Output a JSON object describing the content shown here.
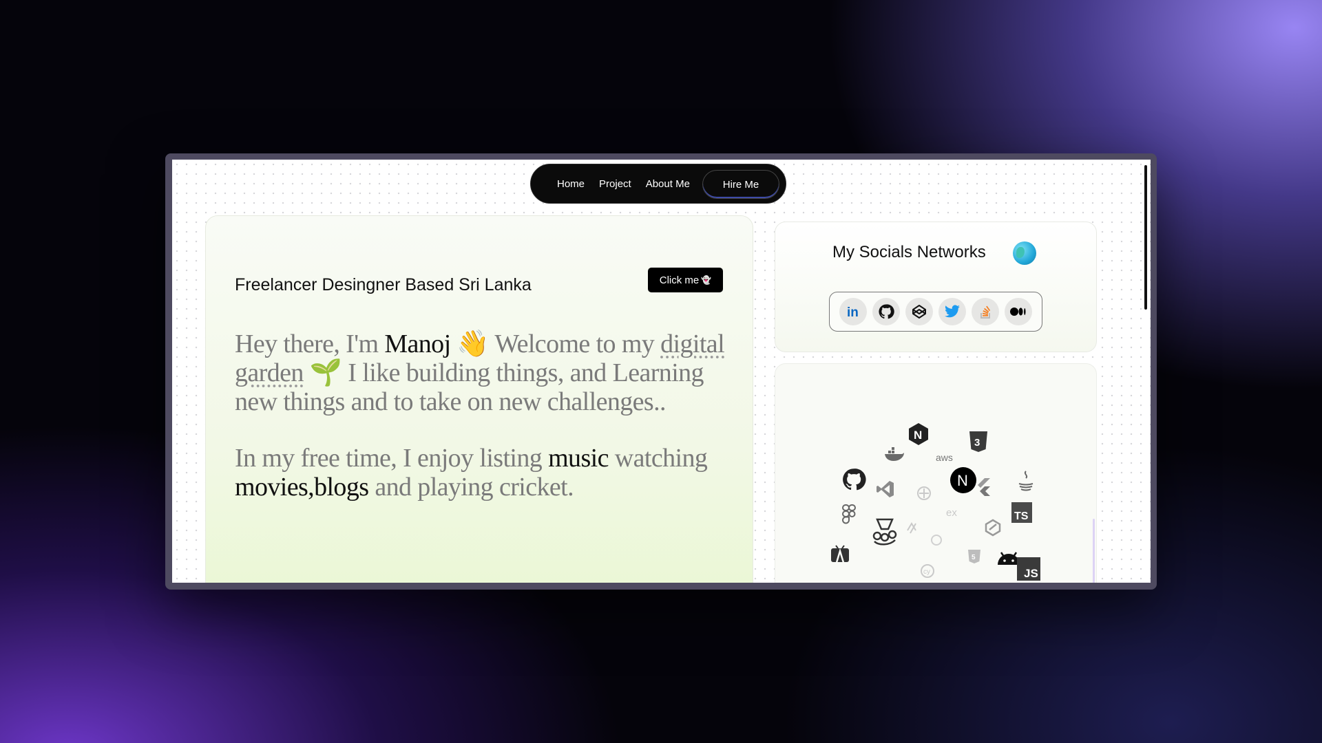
{
  "nav": {
    "items": [
      "Home",
      "Project",
      "About Me"
    ],
    "hire_label": "Hire Me"
  },
  "hero": {
    "tagline": "Freelancer Desingner Based Sri Lanka",
    "click_label": "Click me",
    "click_icon": "ghost-icon",
    "p1": [
      {
        "t": "Hey there, I'm ",
        "s": ""
      },
      {
        "t": "Manoj",
        "s": "hl"
      },
      {
        "t": " 👋 Welcome to my ",
        "s": ""
      },
      {
        "t": "digital garden",
        "s": "dotted"
      },
      {
        "t": " 🌱 I like building things, and Learning new things and to take on new challenges..",
        "s": ""
      }
    ],
    "p2": [
      {
        "t": "In my free time, I enjoy listing ",
        "s": ""
      },
      {
        "t": "music",
        "s": "hl"
      },
      {
        "t": " watching ",
        "s": ""
      },
      {
        "t": "movies,blogs",
        "s": "hl"
      },
      {
        "t": " and playing cricket.",
        "s": ""
      }
    ]
  },
  "socials": {
    "title": "My Socials Networks",
    "title_icon": "globe-icon",
    "links": [
      {
        "name": "linkedin",
        "icon": "linkedin-icon",
        "color": "#0a66c2"
      },
      {
        "name": "github",
        "icon": "github-icon",
        "color": "#111111"
      },
      {
        "name": "codepen",
        "icon": "codepen-icon",
        "color": "#111111"
      },
      {
        "name": "twitter",
        "icon": "twitter-icon",
        "color": "#1d9bf0"
      },
      {
        "name": "stackoverflow",
        "icon": "stackoverflow-icon",
        "color": "#f48024"
      },
      {
        "name": "medium",
        "icon": "medium-icon",
        "color": "#000000"
      }
    ]
  },
  "tech_cloud": {
    "icons": [
      "nextjs-icon",
      "css3-icon",
      "docker-icon",
      "aws-icon",
      "github-icon",
      "vscode-icon",
      "kubernetes-icon",
      "nextjs-icon",
      "flutter-icon",
      "java-icon",
      "figma-icon",
      "jest-icon",
      "express-icon",
      "typescript-icon",
      "redux-icon",
      "android-studio-icon",
      "html5-icon",
      "cypress-icon",
      "android-icon",
      "javascript-icon",
      "gitlab-icon"
    ]
  }
}
